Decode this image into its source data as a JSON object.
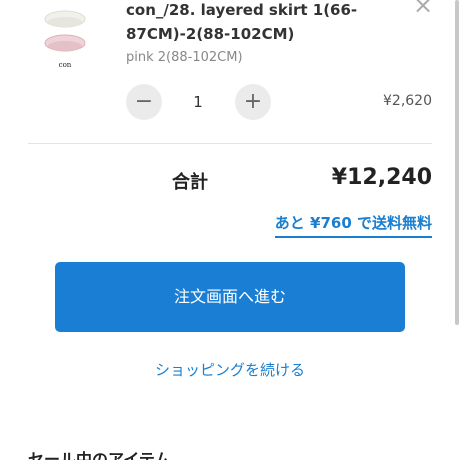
{
  "item": {
    "title": "con_/28. layered skirt 1(66-87CM)-2(88-102CM)",
    "variant": "pink 2(88-102CM)",
    "quantity": "1",
    "price": "¥2,620",
    "thumb_label": "con",
    "minus": "−",
    "plus": "+",
    "close": "×"
  },
  "summary": {
    "total_label": "合計",
    "total_value": "¥12,240",
    "free_shipping_note": "あと ¥760 で送料無料"
  },
  "actions": {
    "checkout": "注文画面へ進む",
    "continue_shopping": "ショッピングを続ける"
  },
  "sale": {
    "heading": "セール中のアイテム"
  },
  "colors": {
    "accent": "#1a7fd4",
    "link": "#1a7fd0"
  }
}
